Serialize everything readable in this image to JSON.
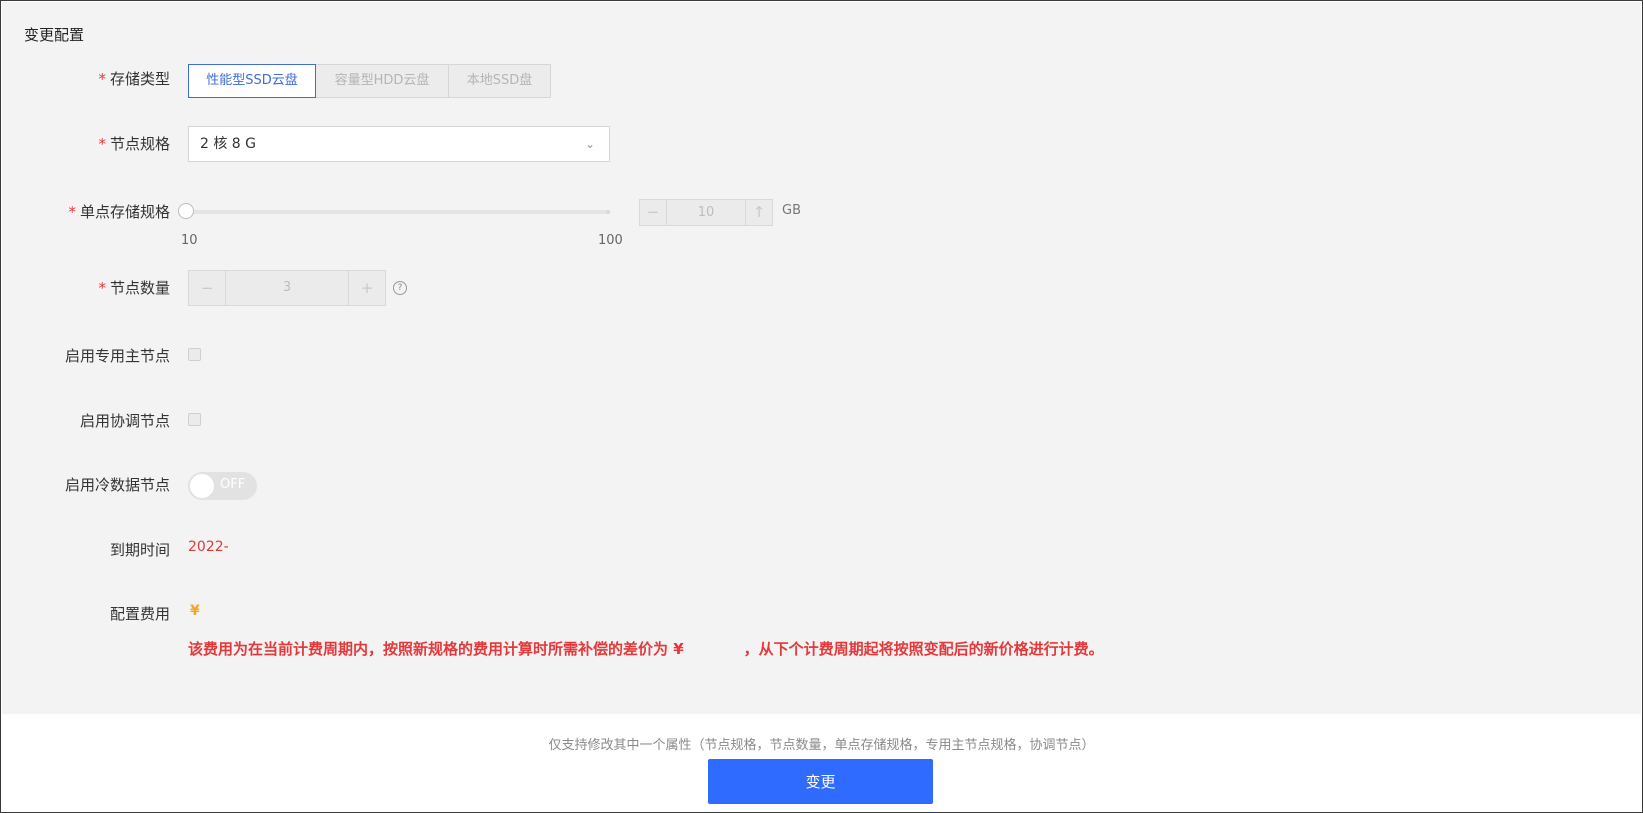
{
  "section_title": "变更配置",
  "storage_type": {
    "label": "存储类型",
    "options": [
      "性能型SSD云盘",
      "容量型HDD云盘",
      "本地SSD盘"
    ],
    "selected": "性能型SSD云盘"
  },
  "node_spec": {
    "label": "节点规格",
    "value": "2 核 8 G"
  },
  "single_storage": {
    "label": "单点存储规格",
    "min_label": "10",
    "max_label": "100",
    "value": "10",
    "unit": "GB",
    "slider_level": 0
  },
  "node_count": {
    "label": "节点数量",
    "value": "3"
  },
  "dedicated_master": {
    "label": "启用专用主节点",
    "checked": false
  },
  "coordinator": {
    "label": "启用协调节点",
    "checked": false
  },
  "cold_data": {
    "label": "启用冷数据节点",
    "state": "OFF"
  },
  "expiry": {
    "label": "到期时间",
    "value": "2022-"
  },
  "fee": {
    "label": "配置费用",
    "value": "¥",
    "notice_pre": "该费用为在当前计费周期内，按照新规格的费用计算时所需补偿的差价为 ¥",
    "notice_post": "，从下个计费周期起将按照变配后的新价格进行计费。"
  },
  "footer": {
    "hint": "仅支持修改其中一个属性（节点规格，节点数量，单点存储规格，专用主节点规格，协调节点）",
    "submit_label": "变更"
  },
  "colors": {
    "primary": "#2f6bfe",
    "danger": "#e5383b",
    "warning": "#f5a623"
  },
  "icons": {
    "select": "chevron-down-icon",
    "help": "question-circle-icon",
    "minus": "minus-icon",
    "plus": "plus-icon"
  }
}
